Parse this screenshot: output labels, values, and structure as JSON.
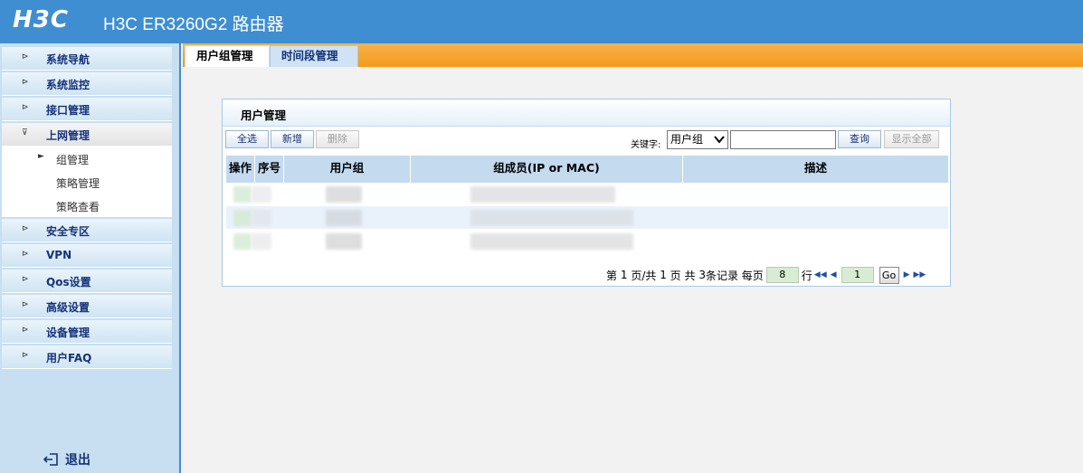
{
  "header": {
    "logo": "H3C",
    "title": "H3C ER3260G2 路由器"
  },
  "sidebar": {
    "items": [
      {
        "label": "系统导航",
        "arrow": "⊳"
      },
      {
        "label": "系统监控",
        "arrow": "⊳"
      },
      {
        "label": "接口管理",
        "arrow": "⊳"
      },
      {
        "label": "上网管理",
        "arrow": "⊽"
      },
      {
        "label": "安全专区",
        "arrow": "⊳"
      },
      {
        "label": "VPN",
        "arrow": "⊳"
      },
      {
        "label": "Qos设置",
        "arrow": "⊳"
      },
      {
        "label": "高级设置",
        "arrow": "⊳"
      },
      {
        "label": "设备管理",
        "arrow": "⊳"
      },
      {
        "label": "用户FAQ",
        "arrow": "⊳"
      }
    ],
    "sub_items": [
      {
        "label": "组管理",
        "marker": "►"
      },
      {
        "label": "策略管理",
        "marker": ""
      },
      {
        "label": "策略查看",
        "marker": ""
      }
    ],
    "logout": "退出"
  },
  "tabs": [
    {
      "label": "用户组管理"
    },
    {
      "label": "时间段管理"
    }
  ],
  "panel": {
    "title": "用户管理",
    "buttons": {
      "select_all": "全选",
      "add": "新增",
      "delete": "删除"
    },
    "keyword_label": "关键字:",
    "keyword_select": "用户组",
    "search_button": "查询",
    "show_all_button": "显示全部",
    "columns": [
      "操作",
      "序号",
      "用户组",
      "组成员(IP or MAC)",
      "描述"
    ]
  },
  "pager": {
    "page_prefix": "第",
    "current_page": "1",
    "page_mid": "页/共",
    "total_pages": "1",
    "page_suffix": "页 共",
    "record_count": "3",
    "records_suffix": "条记录 每页",
    "per_page": "8",
    "rows_suffix": "行",
    "goto_value": "1",
    "go_label": "Go"
  },
  "colors": {
    "header": "#3f8ed2",
    "tabbar": "#f39a1c",
    "sidebar": "#c7dff1",
    "grid_head": "#c3daef"
  }
}
